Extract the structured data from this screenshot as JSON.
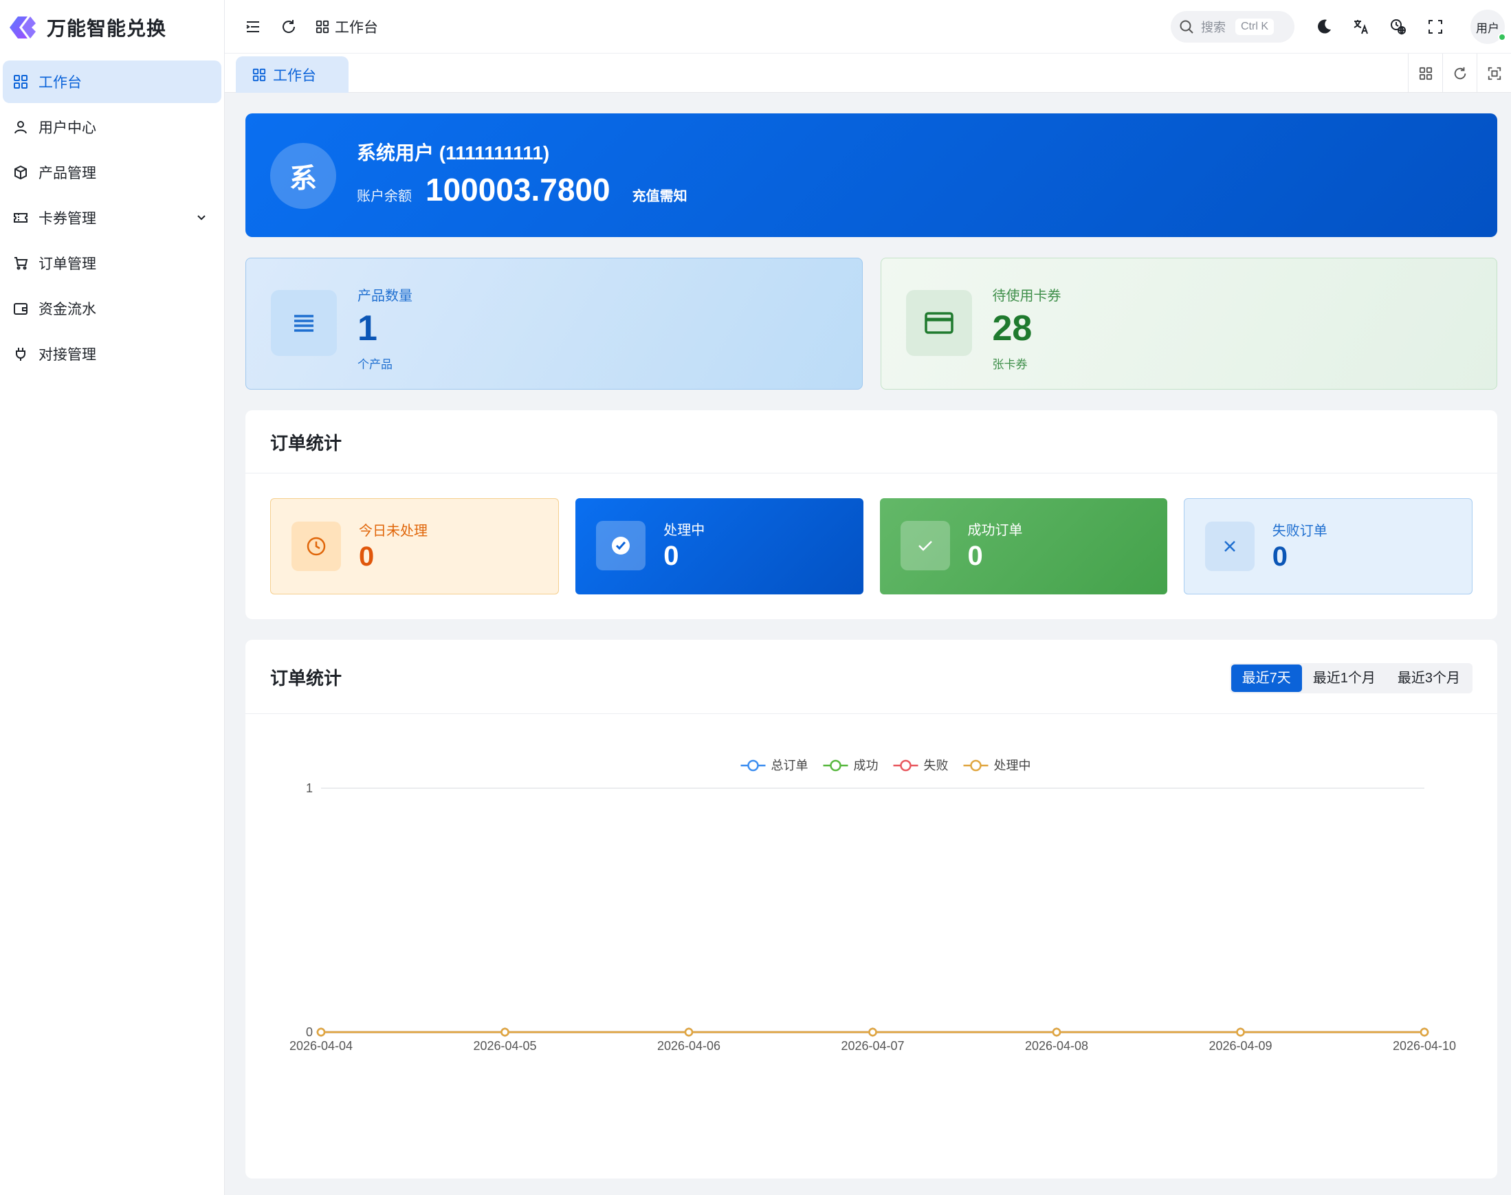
{
  "app": {
    "title": "万能智能兑换"
  },
  "sidebar": {
    "items": [
      {
        "label": "工作台",
        "icon": "dashboard-icon",
        "active": true
      },
      {
        "label": "用户中心",
        "icon": "user-icon"
      },
      {
        "label": "产品管理",
        "icon": "package-icon"
      },
      {
        "label": "卡券管理",
        "icon": "ticket-icon",
        "has_children": true
      },
      {
        "label": "订单管理",
        "icon": "cart-icon"
      },
      {
        "label": "资金流水",
        "icon": "wallet-icon"
      },
      {
        "label": "对接管理",
        "icon": "plug-icon"
      }
    ]
  },
  "header": {
    "breadcrumb": "工作台",
    "search_placeholder": "搜索",
    "search_shortcut": "Ctrl K",
    "user_label": "用户"
  },
  "tabs": [
    {
      "label": "工作台",
      "active": true
    }
  ],
  "banner": {
    "avatar_char": "系",
    "name": "系统用户 (1111111111)",
    "balance_label": "账户余额",
    "balance": "100003.7800",
    "recharge_link": "充值需知"
  },
  "stats": {
    "products": {
      "label": "产品数量",
      "value": "1",
      "unit": "个产品"
    },
    "cards": {
      "label": "待使用卡券",
      "value": "28",
      "unit": "张卡券"
    }
  },
  "order_stats": {
    "title": "订单统计",
    "cards": [
      {
        "label": "今日未处理",
        "value": "0"
      },
      {
        "label": "处理中",
        "value": "0"
      },
      {
        "label": "成功订单",
        "value": "0"
      },
      {
        "label": "失败订单",
        "value": "0"
      }
    ]
  },
  "trend": {
    "title": "订单统计",
    "ranges": [
      "最近7天",
      "最近1个月",
      "最近3个月"
    ],
    "active_range": "最近7天"
  },
  "colors": {
    "primary": "#0b63d9",
    "total": "#3d8ef0",
    "success": "#58b83f",
    "failed": "#e8585f",
    "processing": "#e0a640"
  },
  "chart_data": {
    "type": "line",
    "x": [
      "2026-04-04",
      "2026-04-05",
      "2026-04-06",
      "2026-04-07",
      "2026-04-08",
      "2026-04-09",
      "2026-04-10"
    ],
    "series": [
      {
        "name": "总订单",
        "values": [
          0,
          0,
          0,
          0,
          0,
          0,
          0
        ],
        "color": "#3d8ef0"
      },
      {
        "name": "成功",
        "values": [
          0,
          0,
          0,
          0,
          0,
          0,
          0
        ],
        "color": "#58b83f"
      },
      {
        "name": "失败",
        "values": [
          0,
          0,
          0,
          0,
          0,
          0,
          0
        ],
        "color": "#e8585f"
      },
      {
        "name": "处理中",
        "values": [
          0,
          0,
          0,
          0,
          0,
          0,
          0
        ],
        "color": "#e0a640"
      }
    ],
    "y_ticks": [
      "0",
      "1"
    ],
    "ylim": [
      0,
      1
    ],
    "legend": "top-center",
    "grid": true
  }
}
